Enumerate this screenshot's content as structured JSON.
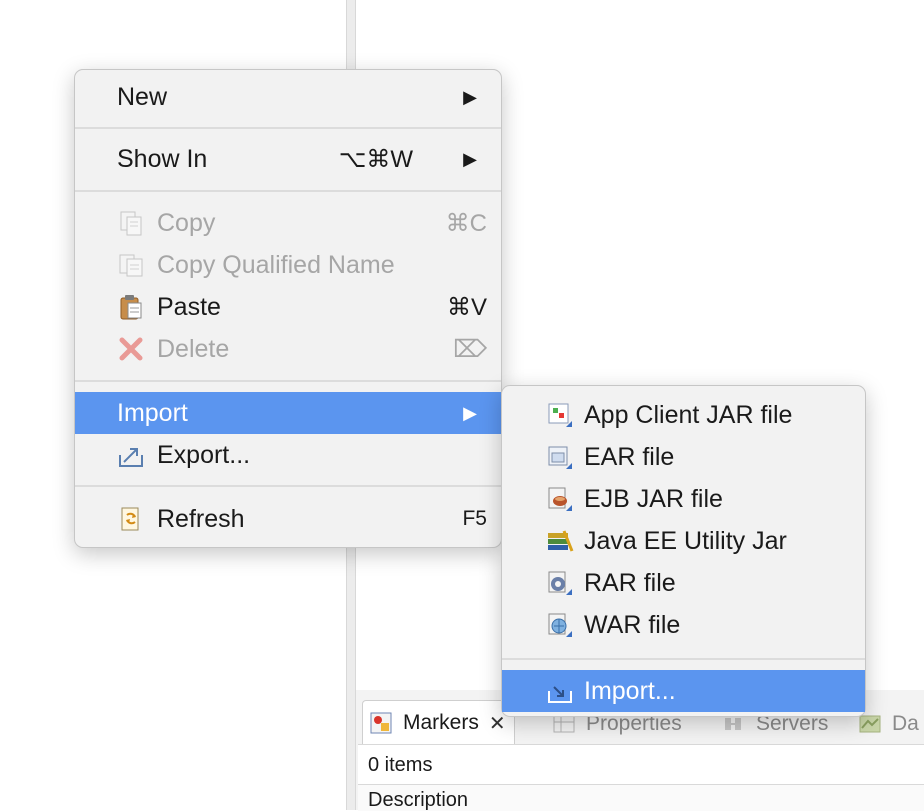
{
  "main_menu": {
    "items": [
      {
        "label": "New",
        "shortcut": "",
        "submenu": true,
        "enabled": true,
        "icon": ""
      },
      {
        "label": "Show In",
        "shortcut": "⌥⌘W",
        "submenu": true,
        "enabled": true,
        "icon": ""
      },
      {
        "label": "Copy",
        "shortcut": "⌘C",
        "submenu": false,
        "enabled": false,
        "icon": "copy-icon"
      },
      {
        "label": "Copy Qualified Name",
        "shortcut": "",
        "submenu": false,
        "enabled": false,
        "icon": "copy-qualified-name-icon"
      },
      {
        "label": "Paste",
        "shortcut": "⌘V",
        "submenu": false,
        "enabled": true,
        "icon": "paste-icon"
      },
      {
        "label": "Delete",
        "shortcut": "⌦",
        "submenu": false,
        "enabled": false,
        "icon": "delete-icon"
      },
      {
        "label": "Import",
        "shortcut": "",
        "submenu": true,
        "enabled": true,
        "selected": true,
        "icon": ""
      },
      {
        "label": "Export...",
        "shortcut": "",
        "submenu": false,
        "enabled": true,
        "icon": "export-icon"
      },
      {
        "label": "Refresh",
        "shortcut": "F5",
        "submenu": false,
        "enabled": true,
        "icon": "refresh-icon"
      }
    ],
    "arrow": "▶"
  },
  "import_submenu": {
    "items": [
      {
        "label": "App Client JAR file",
        "icon": "app-client-jar-icon"
      },
      {
        "label": "EAR file",
        "icon": "ear-file-icon"
      },
      {
        "label": "EJB JAR file",
        "icon": "ejb-jar-icon"
      },
      {
        "label": "Java EE Utility Jar",
        "icon": "java-ee-utility-jar-icon"
      },
      {
        "label": "RAR file",
        "icon": "rar-file-icon"
      },
      {
        "label": "WAR file",
        "icon": "war-file-icon"
      },
      {
        "label": "Import...",
        "icon": "import-wizard-icon",
        "selected": true
      }
    ]
  },
  "bottom_panel": {
    "tabs": [
      {
        "label": "Markers",
        "icon": "markers-icon",
        "active": true
      },
      {
        "label": "Properties",
        "icon": "properties-icon"
      },
      {
        "label": "Servers",
        "icon": "servers-icon"
      },
      {
        "label": "Da",
        "icon": "data-source-icon"
      }
    ],
    "close_glyph": "✕",
    "items_count": "0 items",
    "column_header": "Description"
  },
  "colors": {
    "selection": "#5b95ef",
    "menu_bg": "#f2f2f2",
    "disabled_text": "#a6a6a6"
  }
}
